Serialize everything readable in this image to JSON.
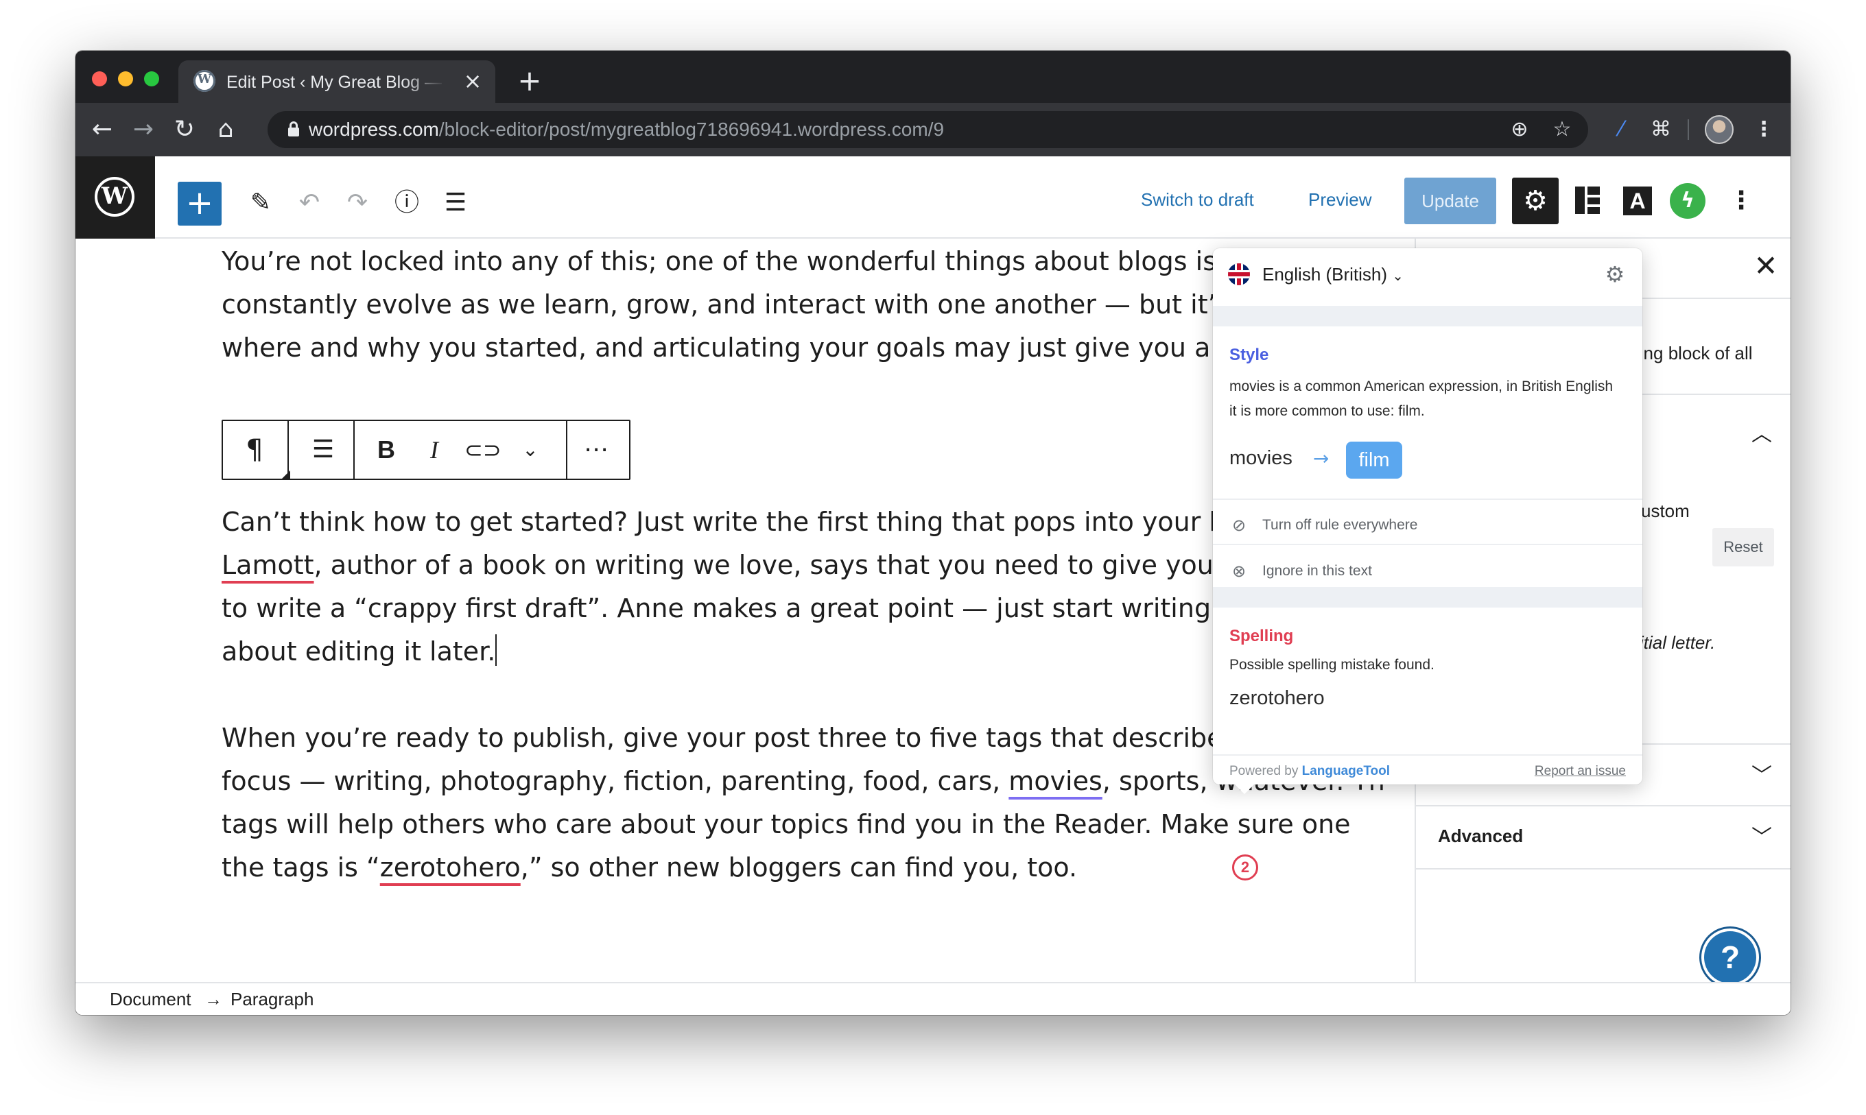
{
  "browser": {
    "tab_title": "Edit Post ‹ My Great Blog — WordPress.com",
    "tab_close": "×",
    "new_tab": "+",
    "url_host": "wordpress.com",
    "url_path": "/block-editor/post/mygreatblog718696941.wordpress.com/9",
    "traffic_colors": [
      "#ff5f57",
      "#febc2e",
      "#28c840"
    ]
  },
  "wp_toolbar": {
    "switch_to_draft": "Switch to draft",
    "preview": "Preview",
    "update": "Update",
    "settings_icon": "gear-icon",
    "accent": "#2271b1"
  },
  "block_toolbar": {
    "paragraph_glyph": "¶",
    "bold": "B",
    "italic": "I",
    "more": "⋯"
  },
  "content": {
    "para1": [
      "You’re not locked into any of this; one of the wonderful things about blogs is how they",
      "constantly evolve as we learn, grow, and interact with one another — but it’s good to kn",
      "where and why you started, and articulating your goals may just give you a few other p"
    ],
    "para2": {
      "l1": "Can’t think how to get started? Just write the first thing that pops into your head. Anne",
      "l2_err": "Lamott",
      "l2_rest": ", author of a book on writing we love, says that you need to give yourself permis",
      "l3": "to write a “crappy first draft”. Anne makes a great point — just start writing, and worry",
      "l4": "about editing it later."
    },
    "para3": {
      "l1": "When you’re ready to publish, give your post three to five tags that describe your blog’s",
      "l2_a": "focus — writing, photography, fiction, parenting, food, cars, ",
      "l2_err": "movies",
      "l2_b": ", sports, whatever. Th",
      "l3": "tags will help others who care about your topics find you in the Reader. Make sure one",
      "l4_a": "the tags is “",
      "l4_err": "zerotohero",
      "l4_b": ",” so other new bloggers can find you, too."
    },
    "error_count": "2",
    "colors": {
      "spelling": "#e03e52",
      "style": "#7d6ef2"
    }
  },
  "sidebar": {
    "frag1": "ling block of all",
    "frag2": "ustom",
    "reset": "Reset",
    "frag3": "itial letter.",
    "advanced": "Advanced"
  },
  "footer": {
    "document": "Document",
    "arrow": "→",
    "paragraph": "Paragraph"
  },
  "languagetool": {
    "language": "English (British)",
    "style": {
      "heading": "Style",
      "color": "#4a5fe0",
      "description": "movies is a common American expression, in British English it is more common to use: film.",
      "original": "movies",
      "suggestion": "film",
      "turn_off": "Turn off rule everywhere",
      "ignore": "Ignore in this text"
    },
    "spelling": {
      "heading": "Spelling",
      "color": "#e03e52",
      "description": "Possible spelling mistake found.",
      "word": "zerotohero"
    },
    "powered_by": "Powered by",
    "brand": "LanguageTool",
    "report": "Report an issue"
  }
}
